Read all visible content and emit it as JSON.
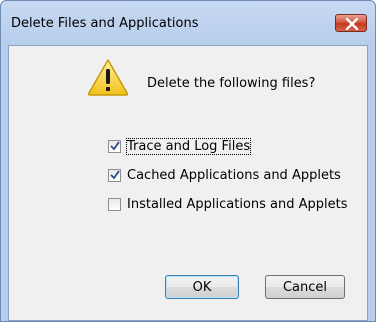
{
  "window": {
    "title": "Delete Files and Applications"
  },
  "icons": {
    "warning": "warning-icon",
    "close": "close-icon",
    "check": "check-icon"
  },
  "message": "Delete the following files?",
  "options": [
    {
      "label": "Trace and Log Files",
      "checked": true
    },
    {
      "label": "Cached Applications and Applets",
      "checked": true
    },
    {
      "label": "Installed Applications and Applets",
      "checked": false
    }
  ],
  "buttons": {
    "ok": "OK",
    "cancel": "Cancel"
  },
  "colors": {
    "title_bar": "#bcd1ee",
    "close_button": "#c33a1f",
    "warning_fill": "#f7d43a",
    "client_background": "#f0f0f0"
  }
}
